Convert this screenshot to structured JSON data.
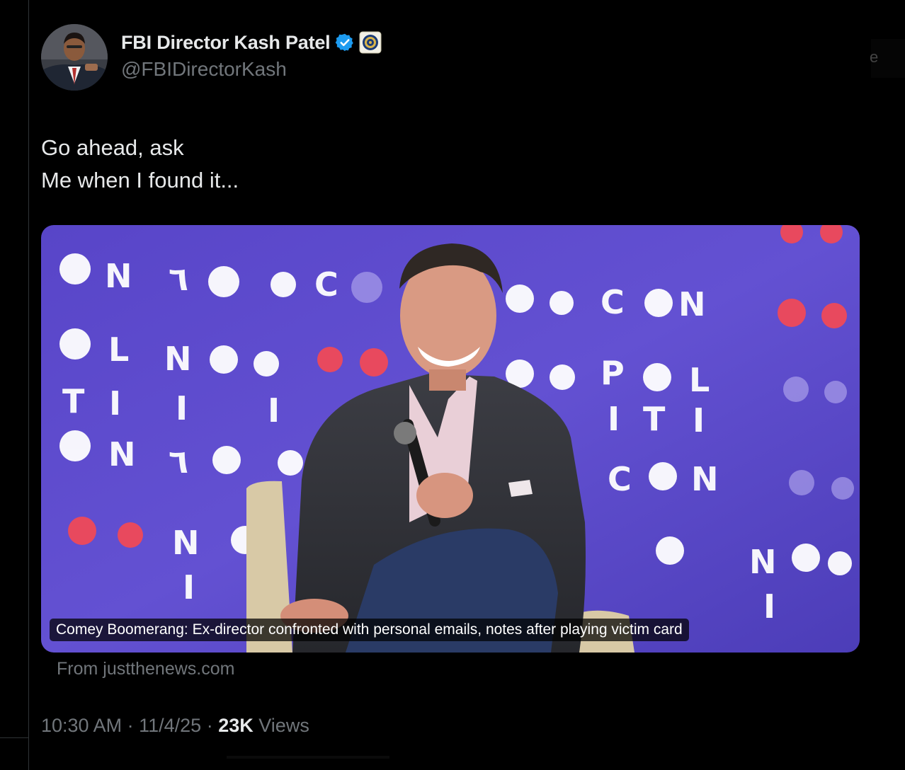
{
  "author": {
    "display_name": "FBI Director Kash Patel",
    "handle": "@FBIDirectorKash",
    "verified_badge": "blue-check-icon",
    "affiliation_badge": "fbi-seal-icon"
  },
  "tweet": {
    "lines": [
      "Go ahead, ask",
      "Me when I found it..."
    ]
  },
  "card": {
    "caption": "Comey Boomerang: Ex-director confronted with personal emails, notes after playing victim card",
    "source": "From justthenews.com"
  },
  "meta": {
    "time": "10:30 AM",
    "sep1": "·",
    "date": "11/4/25",
    "sep2": "·",
    "views_count": "23K",
    "views_label": "Views"
  },
  "colors": {
    "background": "#000000",
    "text_primary": "#e7e9ea",
    "text_secondary": "#71767b",
    "verified": "#1d9bf0",
    "card_backdrop": "#5a49c8",
    "backdrop_accent": "#e8495e"
  }
}
